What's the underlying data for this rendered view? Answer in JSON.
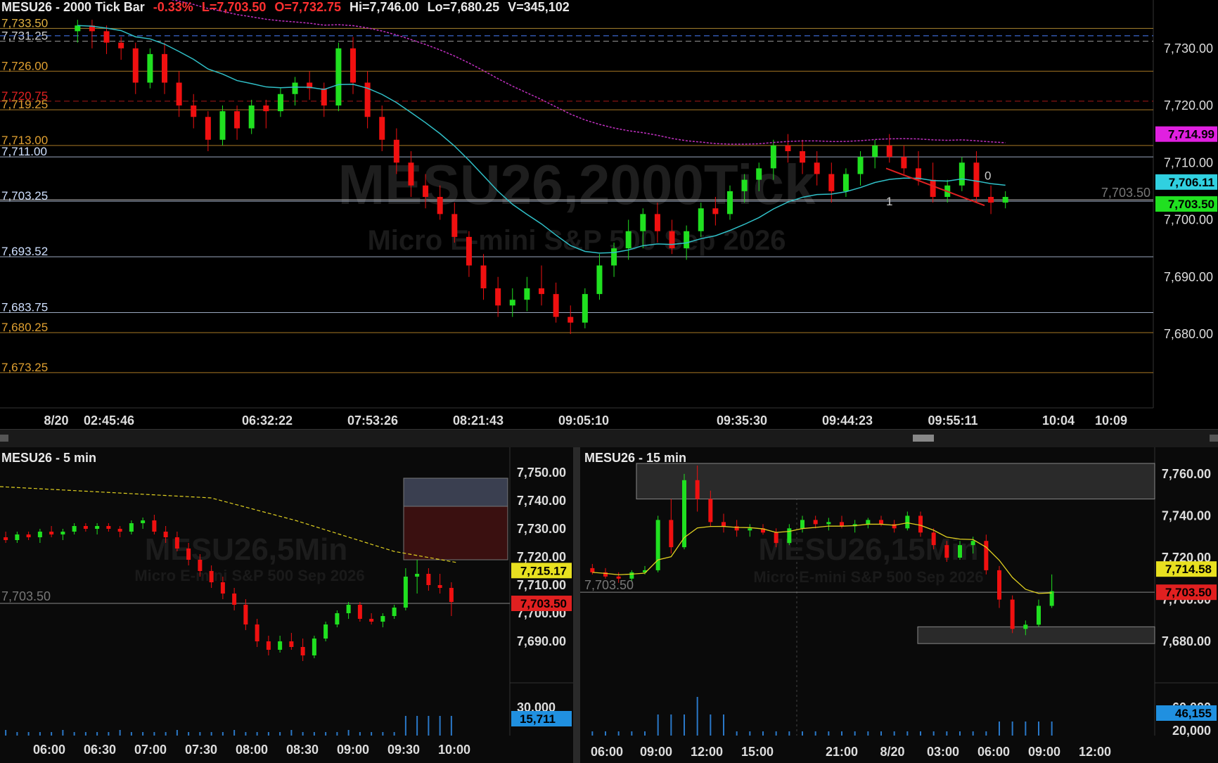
{
  "main": {
    "header": {
      "title": "MESU26 - 2000 Tick Bar",
      "change": "-0.33%",
      "last": "L=7,703.50",
      "open": "O=7,732.75",
      "high": "Hi=7,746.00",
      "low": "Lo=7,680.25",
      "volume": "V=345,102"
    },
    "watermark": "MESU26,2000Tick",
    "watermark_sub": "Micro E-mini S&P 500 Sep 2026",
    "y_axis": [
      "7,730.00",
      "7,720.00",
      "7,710.00",
      "7,700.00",
      "7,690.00",
      "7,680.00"
    ],
    "x_axis": [
      "8/20",
      "02:45:46",
      "06:32:22",
      "07:53:26",
      "08:21:43",
      "09:05:10",
      "09:35:30",
      "09:44:23",
      "09:55:11",
      "10:04",
      "10:09"
    ],
    "levels": [
      {
        "label": "7,733.50",
        "color": "#e0b040"
      },
      {
        "label": "7,731.25",
        "color": "#cfcfcf"
      },
      {
        "label": "7,726.00",
        "color": "#e0a030"
      },
      {
        "label": "7,720.75",
        "color": "#e02020"
      },
      {
        "label": "7,719.25",
        "color": "#e0a030"
      },
      {
        "label": "7,713.00",
        "color": "#e0a030"
      },
      {
        "label": "7,711.00",
        "color": "#cfe0ff"
      },
      {
        "label": "7,703.25",
        "color": "#cfe0ff"
      },
      {
        "label": "7,693.52",
        "color": "#cfe0ff"
      },
      {
        "label": "7,683.75",
        "color": "#cfe0ff"
      },
      {
        "label": "7,680.25",
        "color": "#e0a030"
      },
      {
        "label": "7,673.25",
        "color": "#e0a030"
      }
    ],
    "price_tags": [
      {
        "label": "7,714.99",
        "bg": "#e020e0",
        "fg": "#000"
      },
      {
        "label": "7,706.11",
        "bg": "#30d0e0",
        "fg": "#000"
      },
      {
        "label": "7,703.50",
        "bg": "#20e020",
        "fg": "#000"
      }
    ],
    "last_line_label": "7,703.50",
    "annotations": [
      "0",
      "1"
    ]
  },
  "left": {
    "title": "MESU26 - 5 min",
    "watermark": "MESU26,5Min",
    "watermark_sub": "Micro E-mini S&P 500 Sep 2026",
    "y_axis": [
      "7,750.00",
      "7,740.00",
      "7,730.00",
      "7,720.00",
      "7,710.00",
      "7,700.00",
      "7,690.00"
    ],
    "vol_axis": "30,000",
    "vol_tag": "15,711",
    "price_tags": [
      {
        "label": "7,715.17",
        "bg": "#e8e020"
      },
      {
        "label": "7,703.50",
        "bg": "#e02020"
      }
    ],
    "last_label": "7,703.50",
    "x_axis": [
      "06:00",
      "06:30",
      "07:00",
      "07:30",
      "08:00",
      "08:30",
      "09:00",
      "09:30",
      "10:00"
    ]
  },
  "right": {
    "title": "MESU26 - 15 min",
    "watermark": "MESU26,15Min",
    "watermark_sub": "Micro E-mini S&P 500 Sep 2026",
    "y_axis": [
      "7,760.00",
      "7,740.00",
      "7,720.00",
      "7,700.00",
      "7,680.00"
    ],
    "vol_axis": [
      "60,000",
      "20,000"
    ],
    "vol_tag": "46,155",
    "price_tags": [
      {
        "label": "7,714.58",
        "bg": "#e8e020"
      },
      {
        "label": "7,703.50",
        "bg": "#e02020"
      }
    ],
    "last_label": "7,703.50",
    "x_axis": [
      "06:00",
      "09:00",
      "12:00",
      "15:00",
      "21:00",
      "8/20",
      "03:00",
      "06:00",
      "09:00",
      "12:00"
    ]
  },
  "chart_data": [
    {
      "type": "candlestick",
      "title": "MESU26 - 2000 Tick Bar",
      "ylim": [
        7672,
        7736
      ],
      "ohlc": [
        [
          7733,
          7735,
          7731,
          7734
        ],
        [
          7734,
          7735,
          7730,
          7733
        ],
        [
          7733,
          7734,
          7729,
          7731
        ],
        [
          7731,
          7732,
          7728,
          7730
        ],
        [
          7730,
          7731,
          7722,
          7724
        ],
        [
          7724,
          7730,
          7723,
          7729
        ],
        [
          7729,
          7731,
          7722,
          7724
        ],
        [
          7724,
          7726,
          7718,
          7720
        ],
        [
          7720,
          7722,
          7716,
          7718
        ],
        [
          7718,
          7719,
          7712,
          7714
        ],
        [
          7714,
          7720,
          7713,
          7719
        ],
        [
          7719,
          7720,
          7714,
          7716
        ],
        [
          7716,
          7721,
          7715,
          7720
        ],
        [
          7720,
          7721,
          7716,
          7719
        ],
        [
          7719,
          7723,
          7718,
          7722
        ],
        [
          7722,
          7725,
          7720,
          7724
        ],
        [
          7724,
          7726,
          7721,
          7723
        ],
        [
          7723,
          7724,
          7718,
          7720
        ],
        [
          7720,
          7731,
          7719,
          7730
        ],
        [
          7730,
          7732,
          7722,
          7724
        ],
        [
          7724,
          7726,
          7716,
          7718
        ],
        [
          7718,
          7720,
          7712,
          7714
        ],
        [
          7714,
          7716,
          7708,
          7710
        ],
        [
          7710,
          7712,
          7704,
          7706
        ],
        [
          7706,
          7708,
          7702,
          7704
        ],
        [
          7704,
          7706,
          7700,
          7701
        ],
        [
          7701,
          7703,
          7696,
          7697
        ],
        [
          7697,
          7698,
          7690,
          7692
        ],
        [
          7692,
          7694,
          7686,
          7688
        ],
        [
          7688,
          7690,
          7683,
          7685
        ],
        [
          7685,
          7688,
          7683,
          7686
        ],
        [
          7686,
          7690,
          7684,
          7688
        ],
        [
          7688,
          7692,
          7685,
          7687
        ],
        [
          7687,
          7689,
          7682,
          7683
        ],
        [
          7683,
          7685,
          7680,
          7682
        ],
        [
          7682,
          7688,
          7681,
          7687
        ],
        [
          7687,
          7694,
          7686,
          7692
        ],
        [
          7692,
          7696,
          7690,
          7695
        ],
        [
          7695,
          7700,
          7693,
          7698
        ],
        [
          7698,
          7702,
          7695,
          7701
        ],
        [
          7701,
          7703,
          7696,
          7698
        ],
        [
          7698,
          7700,
          7694,
          7695
        ],
        [
          7695,
          7699,
          7693,
          7698
        ],
        [
          7698,
          7703,
          7697,
          7702
        ],
        [
          7702,
          7704,
          7699,
          7701
        ],
        [
          7701,
          7706,
          7700,
          7705
        ],
        [
          7705,
          7708,
          7703,
          7707
        ],
        [
          7707,
          7710,
          7705,
          7709
        ],
        [
          7709,
          7714,
          7707,
          7713
        ],
        [
          7713,
          7715,
          7710,
          7712
        ],
        [
          7712,
          7714,
          7708,
          7710
        ],
        [
          7710,
          7712,
          7706,
          7708
        ],
        [
          7708,
          7710,
          7703,
          7705
        ],
        [
          7705,
          7709,
          7704,
          7708
        ],
        [
          7708,
          7712,
          7706,
          7711
        ],
        [
          7711,
          7714,
          7709,
          7713
        ],
        [
          7713,
          7715,
          7710,
          7711
        ],
        [
          7711,
          7713,
          7708,
          7709
        ],
        [
          7709,
          7712,
          7706,
          7707
        ],
        [
          7707,
          7710,
          7703,
          7704
        ],
        [
          7704,
          7707,
          7703,
          7706
        ],
        [
          7706,
          7711,
          7705,
          7710
        ],
        [
          7710,
          7712,
          7703,
          7704
        ],
        [
          7704,
          7706,
          7701,
          7703
        ],
        [
          7703,
          7705,
          7702,
          7704
        ]
      ]
    },
    {
      "type": "candlestick",
      "title": "MESU26 - 5 min",
      "ylim": [
        7684,
        7754
      ],
      "ohlc": [
        [
          7727,
          7729,
          7725,
          7726
        ],
        [
          7726,
          7729,
          7725,
          7728
        ],
        [
          7728,
          7729,
          7726,
          7727
        ],
        [
          7727,
          7730,
          7725,
          7729
        ],
        [
          7729,
          7731,
          7727,
          7728
        ],
        [
          7728,
          7730,
          7726,
          7729
        ],
        [
          7729,
          7732,
          7728,
          7731
        ],
        [
          7731,
          7732,
          7729,
          7730
        ],
        [
          7730,
          7732,
          7728,
          7731
        ],
        [
          7731,
          7732,
          7729,
          7730
        ],
        [
          7730,
          7731,
          7727,
          7729
        ],
        [
          7729,
          7733,
          7728,
          7732
        ],
        [
          7732,
          7734,
          7730,
          7733
        ],
        [
          7733,
          7735,
          7728,
          7729
        ],
        [
          7729,
          7731,
          7725,
          7727
        ],
        [
          7727,
          7729,
          7722,
          7723
        ],
        [
          7723,
          7725,
          7717,
          7719
        ],
        [
          7719,
          7721,
          7713,
          7715
        ],
        [
          7715,
          7717,
          7709,
          7711
        ],
        [
          7711,
          7713,
          7705,
          7707
        ],
        [
          7707,
          7709,
          7701,
          7703
        ],
        [
          7703,
          7705,
          7694,
          7696
        ],
        [
          7696,
          7698,
          7688,
          7690
        ],
        [
          7690,
          7692,
          7685,
          7687
        ],
        [
          7687,
          7692,
          7686,
          7690
        ],
        [
          7690,
          7693,
          7687,
          7688
        ],
        [
          7688,
          7691,
          7683,
          7685
        ],
        [
          7685,
          7692,
          7684,
          7691
        ],
        [
          7691,
          7697,
          7690,
          7696
        ],
        [
          7696,
          7701,
          7695,
          7700
        ],
        [
          7700,
          7704,
          7698,
          7703
        ],
        [
          7703,
          7704,
          7697,
          7698
        ],
        [
          7698,
          7700,
          7696,
          7697
        ],
        [
          7697,
          7700,
          7695,
          7699
        ],
        [
          7699,
          7703,
          7698,
          7702
        ],
        [
          7702,
          7716,
          7701,
          7713
        ],
        [
          7713,
          7719,
          7707,
          7714
        ],
        [
          7714,
          7716,
          7708,
          7710
        ],
        [
          7710,
          7714,
          7707,
          7709
        ],
        [
          7709,
          7711,
          7699,
          7704
        ]
      ]
    },
    {
      "type": "candlestick",
      "title": "MESU26 - 15 min",
      "ylim": [
        7672,
        7766
      ],
      "ohlc": [
        [
          7715,
          7717,
          7712,
          7713
        ],
        [
          7713,
          7715,
          7710,
          7711
        ],
        [
          7711,
          7713,
          7708,
          7710
        ],
        [
          7710,
          7714,
          7709,
          7713
        ],
        [
          7713,
          7716,
          7712,
          7714
        ],
        [
          7714,
          7740,
          7713,
          7738
        ],
        [
          7738,
          7748,
          7722,
          7725
        ],
        [
          7725,
          7760,
          7724,
          7757
        ],
        [
          7757,
          7764,
          7742,
          7748
        ],
        [
          7748,
          7752,
          7735,
          7737
        ],
        [
          7737,
          7741,
          7732,
          7735
        ],
        [
          7735,
          7738,
          7730,
          7733
        ],
        [
          7733,
          7736,
          7730,
          7734
        ],
        [
          7734,
          7736,
          7731,
          7732
        ],
        [
          7732,
          7734,
          7725,
          7727
        ],
        [
          7727,
          7736,
          7726,
          7734
        ],
        [
          7734,
          7740,
          7732,
          7738
        ],
        [
          7738,
          7740,
          7734,
          7736
        ],
        [
          7736,
          7739,
          7733,
          7737
        ],
        [
          7737,
          7740,
          7734,
          7735
        ],
        [
          7735,
          7738,
          7732,
          7736
        ],
        [
          7736,
          7739,
          7734,
          7738
        ],
        [
          7738,
          7740,
          7735,
          7736
        ],
        [
          7736,
          7738,
          7732,
          7734
        ],
        [
          7734,
          7742,
          7733,
          7740
        ],
        [
          7740,
          7742,
          7730,
          7732
        ],
        [
          7732,
          7734,
          7724,
          7726
        ],
        [
          7726,
          7728,
          7718,
          7720
        ],
        [
          7720,
          7728,
          7719,
          7726
        ],
        [
          7726,
          7730,
          7722,
          7728
        ],
        [
          7728,
          7731,
          7712,
          7714
        ],
        [
          7714,
          7716,
          7696,
          7700
        ],
        [
          7700,
          7702,
          7684,
          7686
        ],
        [
          7686,
          7690,
          7683,
          7688
        ],
        [
          7688,
          7700,
          7687,
          7697
        ],
        [
          7697,
          7712,
          7696,
          7704
        ]
      ]
    }
  ]
}
